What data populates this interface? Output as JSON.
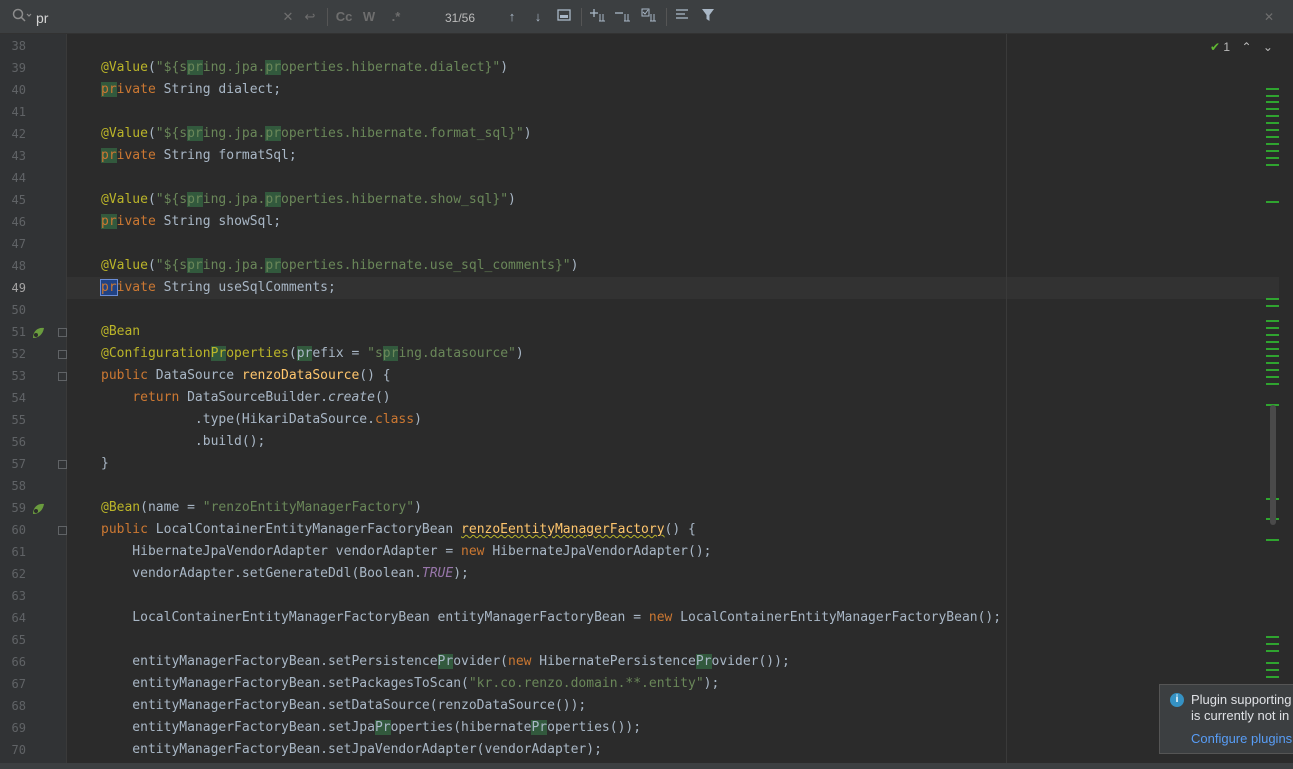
{
  "search": {
    "query": "pr",
    "match_count": "31/56",
    "case_label": "Cc",
    "word_label": "W",
    "regex_label": ".*"
  },
  "inspection": {
    "count": "1"
  },
  "notification": {
    "line1": "Plugin supporting",
    "line2": "is currently not in",
    "link": "Configure plugins"
  },
  "colors": {
    "keyword": "#cc7832",
    "annotation": "#bbb529",
    "string": "#6a8759",
    "method": "#ffc66d",
    "search_highlight": "#32593d",
    "current_match": "#214283"
  },
  "editor": {
    "lines": [
      {
        "n": "38",
        "t": ""
      },
      {
        "n": "39",
        "t": "@Value(\"${spring.jpa.properties.hibernate.dialect}\")"
      },
      {
        "n": "40",
        "t": "private String dialect;"
      },
      {
        "n": "41",
        "t": ""
      },
      {
        "n": "42",
        "t": "@Value(\"${spring.jpa.properties.hibernate.format_sql}\")"
      },
      {
        "n": "43",
        "t": "private String formatSql;"
      },
      {
        "n": "44",
        "t": ""
      },
      {
        "n": "45",
        "t": "@Value(\"${spring.jpa.properties.hibernate.show_sql}\")"
      },
      {
        "n": "46",
        "t": "private String showSql;"
      },
      {
        "n": "47",
        "t": ""
      },
      {
        "n": "48",
        "t": "@Value(\"${spring.jpa.properties.hibernate.use_sql_comments}\")"
      },
      {
        "n": "49",
        "t": "private String useSqlComments;"
      },
      {
        "n": "50",
        "t": ""
      },
      {
        "n": "51",
        "t": "@Bean"
      },
      {
        "n": "52",
        "t": "@ConfigurationProperties(prefix = \"spring.datasource\")"
      },
      {
        "n": "53",
        "t": "public DataSource renzoDataSource() {"
      },
      {
        "n": "54",
        "t": "    return DataSourceBuilder.create()"
      },
      {
        "n": "55",
        "t": "            .type(HikariDataSource.class)"
      },
      {
        "n": "56",
        "t": "            .build();"
      },
      {
        "n": "57",
        "t": "}"
      },
      {
        "n": "58",
        "t": ""
      },
      {
        "n": "59",
        "t": "@Bean(name = \"renzoEntityManagerFactory\")"
      },
      {
        "n": "60",
        "t": "public LocalContainerEntityManagerFactoryBean renzoEentityManagerFactory() {"
      },
      {
        "n": "61",
        "t": "    HibernateJpaVendorAdapter vendorAdapter = new HibernateJpaVendorAdapter();"
      },
      {
        "n": "62",
        "t": "    vendorAdapter.setGenerateDdl(Boolean.TRUE);"
      },
      {
        "n": "63",
        "t": ""
      },
      {
        "n": "64",
        "t": "    LocalContainerEntityManagerFactoryBean entityManagerFactoryBean = new LocalContainerEntityManagerFactoryBean();"
      },
      {
        "n": "65",
        "t": ""
      },
      {
        "n": "66",
        "t": "    entityManagerFactoryBean.setPersistenceProvider(new HibernatePersistenceProvider());"
      },
      {
        "n": "67",
        "t": "    entityManagerFactoryBean.setPackagesToScan(\"kr.co.renzo.domain.**.entity\");"
      },
      {
        "n": "68",
        "t": "    entityManagerFactoryBean.setDataSource(renzoDataSource());"
      },
      {
        "n": "69",
        "t": "    entityManagerFactoryBean.setJpaProperties(hibernateProperties());"
      },
      {
        "n": "70",
        "t": "    entityManagerFactoryBean.setJpaVendorAdapter(vendorAdapter);"
      }
    ]
  }
}
